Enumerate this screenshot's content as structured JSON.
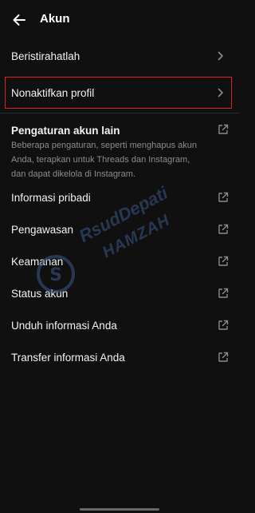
{
  "header": {
    "back_icon": "arrow-left-icon",
    "title": "Akun"
  },
  "menu_top": [
    {
      "label": "Beristirahatlah",
      "icon": "chevron-right-icon"
    },
    {
      "label": "Nonaktifkan profil",
      "icon": "chevron-right-icon",
      "highlighted": true
    }
  ],
  "other_settings": {
    "title": "Pengaturan akun lain",
    "description": "Beberapa pengaturan, seperti menghapus akun Anda, terapkan untuk Threads dan Instagram, dan dapat dikelola di Instagram.",
    "icon": "external-link-icon"
  },
  "menu_links": [
    {
      "label": "Informasi pribadi",
      "icon": "external-link-icon"
    },
    {
      "label": "Pengawasan",
      "icon": "external-link-icon"
    },
    {
      "label": "Keamanan",
      "icon": "external-link-icon"
    },
    {
      "label": "Status akun",
      "icon": "external-link-icon"
    },
    {
      "label": "Unduh informasi Anda",
      "icon": "external-link-icon"
    },
    {
      "label": "Transfer informasi Anda",
      "icon": "external-link-icon"
    }
  ],
  "watermark": {
    "line1": "RsudDepati",
    "line2": "HAMZAH"
  },
  "colors": {
    "background": "#101010",
    "highlight_border": "#e01c1c",
    "secondary_text": "#8c8c8c"
  }
}
